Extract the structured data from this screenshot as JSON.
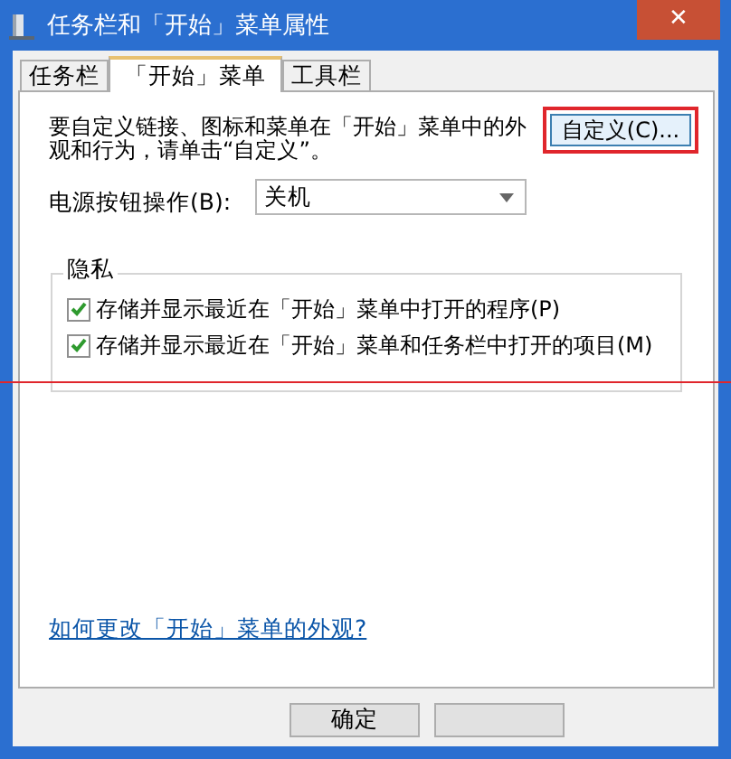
{
  "window": {
    "title": "任务栏和「开始」菜单属性",
    "close": "✕"
  },
  "tabs": [
    {
      "label": "任务栏",
      "selected": false
    },
    {
      "label": "「开始」菜单",
      "selected": true
    },
    {
      "label": "工具栏",
      "selected": false
    }
  ],
  "intro": {
    "text": "要自定义链接、图标和菜单在「开始」菜单中的外观和行为，请单击“自定义”。",
    "button": "自定义(C)...",
    "highlighted": true
  },
  "power": {
    "label": "电源按钮操作(B):",
    "value": "关机"
  },
  "privacy": {
    "title": "隐私",
    "options": [
      {
        "label": "存储并显示最近在「开始」菜单中打开的程序(P)",
        "checked": true
      },
      {
        "label": "存储并显示最近在「开始」菜单和任务栏中打开的项目(M)",
        "checked": true
      }
    ]
  },
  "annotation_line": true,
  "help_link": "如何更改「开始」菜单的外观?",
  "buttons": [
    {
      "kind": "text",
      "label": "确定"
    },
    {
      "kind": "blank"
    }
  ]
}
